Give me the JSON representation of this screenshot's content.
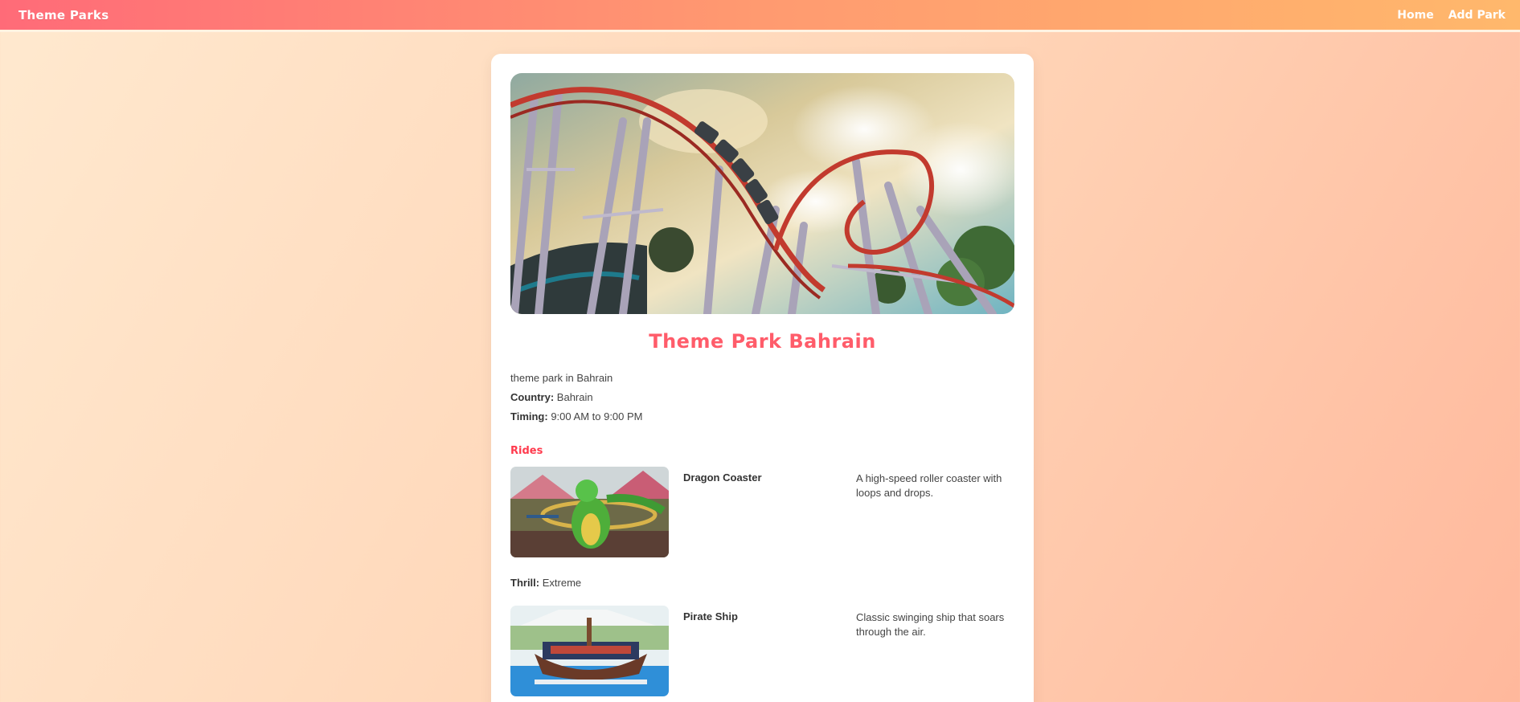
{
  "nav": {
    "brand": "Theme Parks",
    "links": [
      "Home",
      "Add Park"
    ]
  },
  "park": {
    "name": "Theme Park Bahrain",
    "description": "theme park in Bahrain",
    "country_label": "Country:",
    "country": "Bahrain",
    "timing_label": "Timing:",
    "timing": "9:00 AM to 9:00 PM"
  },
  "rides_heading": "Rides",
  "rides": [
    {
      "name": "Dragon Coaster",
      "description": "A high-speed roller coaster with loops and drops.",
      "thrill_label": "Thrill:",
      "thrill": "Extreme"
    },
    {
      "name": "Pirate Ship",
      "description": "Classic swinging ship that soars through the air."
    }
  ],
  "colors": {
    "accent": "#ff5c6a",
    "nav_start": "#ff6b78",
    "nav_end": "#ffb86c"
  },
  "icons": {
    "hero_image": "roller-coaster-photo",
    "ride_1_image": "dragon-coaster-photo",
    "ride_2_image": "pirate-ship-photo"
  }
}
